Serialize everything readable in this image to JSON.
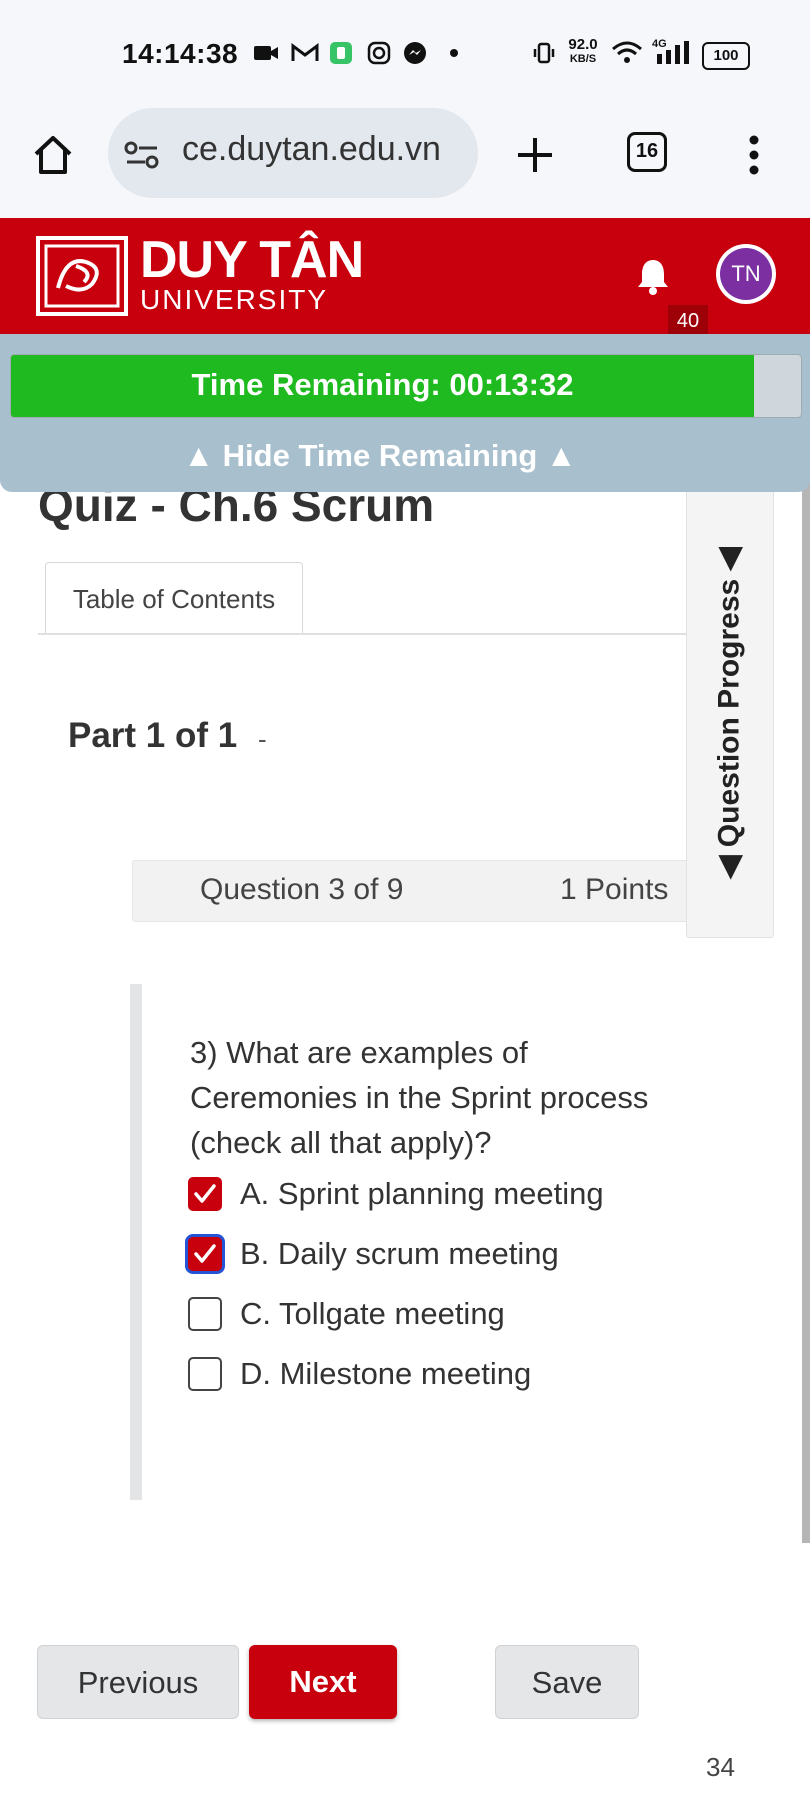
{
  "status_bar": {
    "time": "14:14:38",
    "net_speed_value": "92.0",
    "net_speed_unit": "KB/S",
    "network": "4G",
    "battery": "100"
  },
  "browser": {
    "url": "ce.duytan.edu.vn",
    "tab_count": "16"
  },
  "header": {
    "brand_name": "DUY TÂN",
    "brand_sub": "UNIVERSITY",
    "notification_count": "40",
    "avatar_initials": "TN",
    "brand_color": "#c8000e"
  },
  "timer": {
    "text": "Time Remaining: 00:13:32",
    "remaining_fraction": 0.94,
    "hide_label": "▲ Hide Time Remaining ▲"
  },
  "quiz": {
    "title": "Quiz - Ch.6 Scrum",
    "toc_tab": "Table of Contents",
    "part": "Part 1 of 1",
    "part_suffix": "-",
    "question_label": "Question 3 of 9",
    "points": "1 Points",
    "progress_tab": "◀ Question Progress ◀",
    "question_text": "3) What are examples of Ceremonies in the Sprint process (check all that apply)?",
    "options": [
      {
        "label": "A. Sprint planning meeting",
        "checked": true
      },
      {
        "label": "B. Daily scrum meeting",
        "checked": true
      },
      {
        "label": "C. Tollgate meeting",
        "checked": false
      },
      {
        "label": "D. Milestone meeting",
        "checked": false
      }
    ]
  },
  "buttons": {
    "previous": "Previous",
    "next": "Next",
    "save": "Save"
  },
  "page_number": "34"
}
